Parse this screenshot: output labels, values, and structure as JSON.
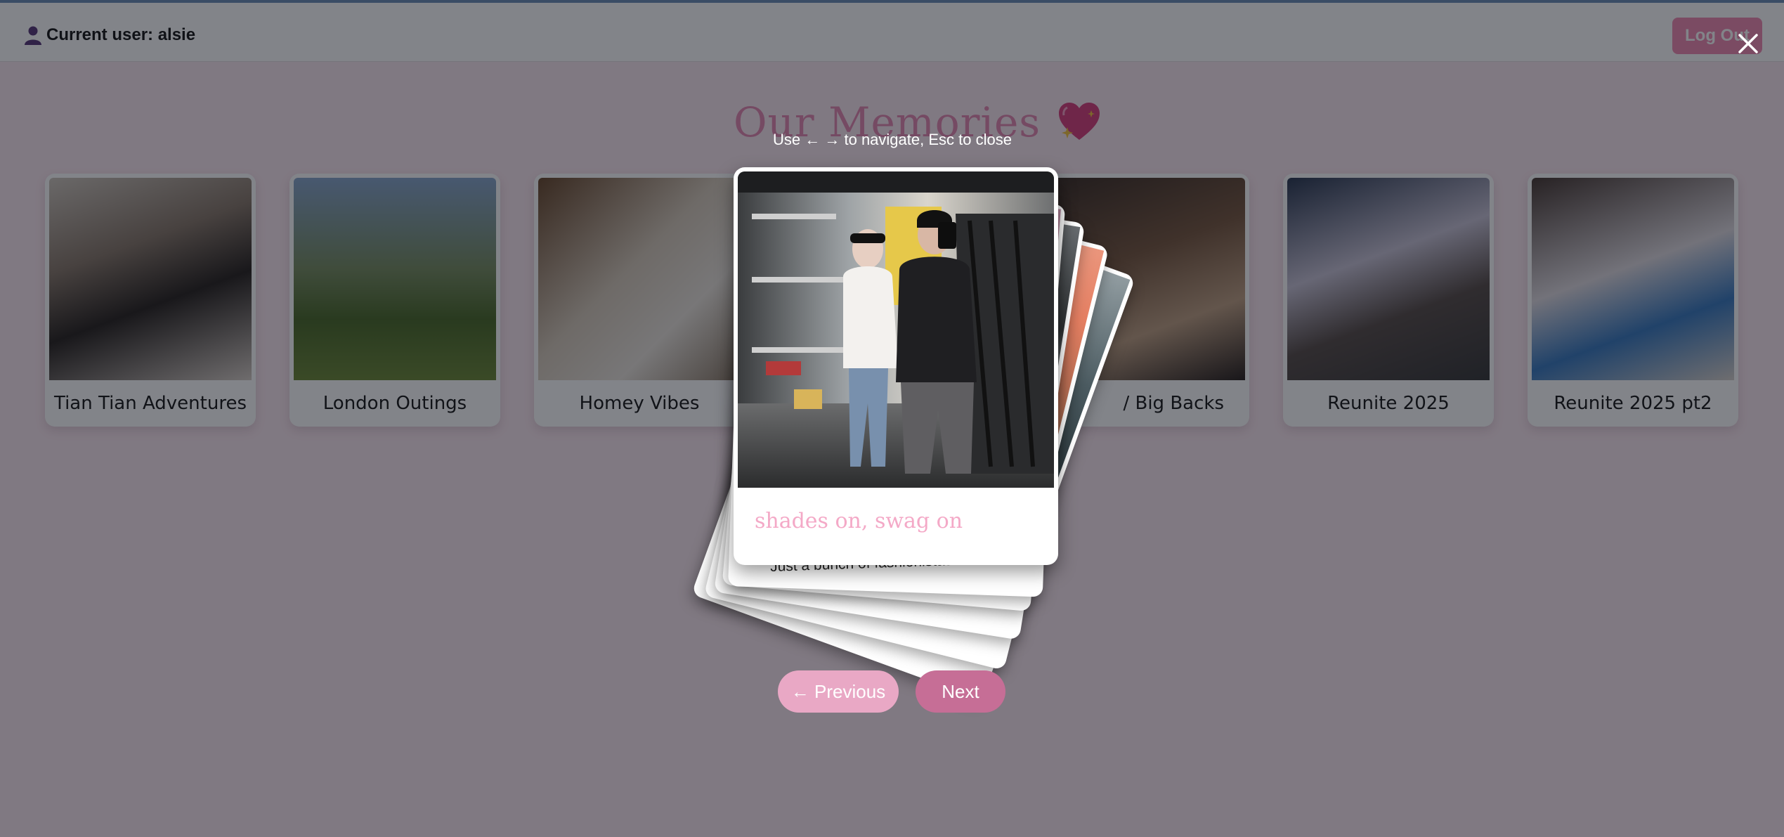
{
  "header": {
    "user_text": "Current user: alsie",
    "logout_label": "Log Out"
  },
  "page": {
    "title": "Our Memories"
  },
  "albums": [
    {
      "label": "Tian Tian Adventures"
    },
    {
      "label": "London Outings"
    },
    {
      "label": "Homey Vibes"
    },
    {
      "label": "/ Big Backs"
    },
    {
      "label": "Reunite 2025"
    },
    {
      "label": "Reunite 2025 pt2"
    }
  ],
  "viewer": {
    "hint": "Use ← → to navigate, Esc to close",
    "caption": "shades on, swag on",
    "behind_text": "Just a bunch of fashionistas",
    "prev_label": "← Previous",
    "next_label": "Next"
  },
  "colors": {
    "accent_pink": "#f08cb3",
    "title_pink": "#e48ab3",
    "caption_pink": "#f4a9c7",
    "overlay": "rgba(5,10,20,0.5)"
  },
  "icons": {
    "user": "user-icon",
    "heart": "sparkling-heart-icon",
    "close": "close-icon"
  }
}
